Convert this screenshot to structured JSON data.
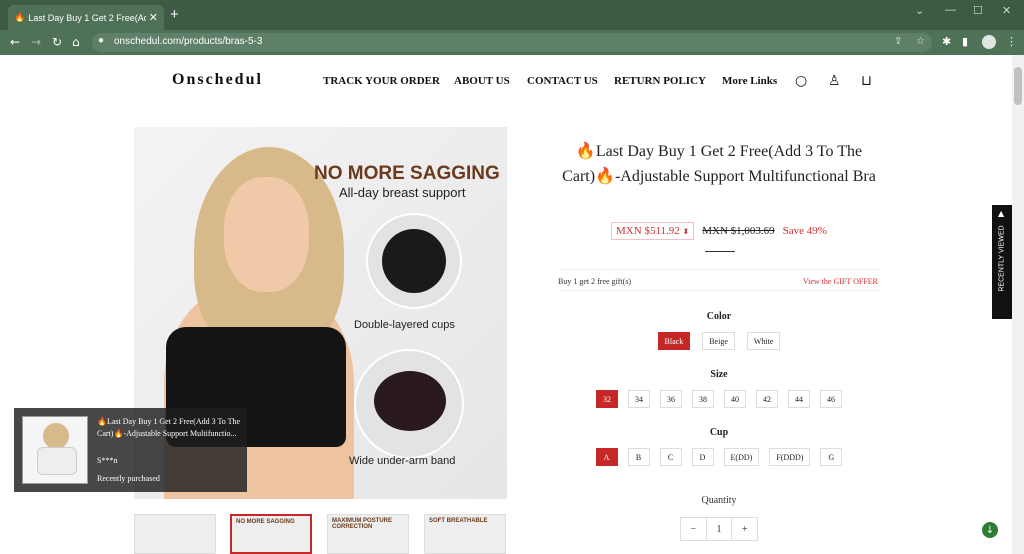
{
  "browser": {
    "tab_title": "Last Day Buy 1 Get 2 Free(Add",
    "tab_favicon": "🔥",
    "new_tab": "+",
    "url": "onschedul.com/products/bras-5-3",
    "window_controls": {
      "collapse": "⌄",
      "minimize": "—",
      "maximize": "☐",
      "close": "✕"
    }
  },
  "header": {
    "logo": "Onschedul",
    "nav": [
      "TRACK YOUR ORDER",
      "ABOUT US",
      "CONTACT US",
      "RETURN POLICY",
      "More Links"
    ],
    "icons": [
      "search-icon",
      "account-icon",
      "cart-icon"
    ]
  },
  "hero": {
    "headline": "NO MORE SAGGING",
    "subheadline": "All-day breast support",
    "caption1": "Double-layered cups",
    "caption2": "Wide under-arm band"
  },
  "thumbnails": [
    {
      "text": ""
    },
    {
      "text": "NO MORE SAGGING"
    },
    {
      "text": "MAXIMUM POSTURE CORRECTION"
    },
    {
      "text": "SOFT BREATHABLE"
    }
  ],
  "popup": {
    "title": "🔥Last Day Buy 1 Get 2 Free(Add 3 To The Cart)🔥-Adjustable Support Multifunctio...",
    "name": "S***n",
    "status": "Recently purchased"
  },
  "product": {
    "title": "🔥Last Day Buy 1 Get 2 Free(Add 3 To The Cart)🔥-Adjustable Support Multifunctional Bra",
    "price": "MXN $511.92",
    "old_price": "MXN $1,003.69",
    "save": "Save 49%",
    "gift_left": "Buy 1 get 2 free gift(s)",
    "gift_right": "View the GIFT OFFER",
    "color_label": "Color",
    "colors": [
      "Black",
      "Beige",
      "White"
    ],
    "size_label": "Size",
    "sizes": [
      "32",
      "34",
      "36",
      "38",
      "40",
      "42",
      "44",
      "46"
    ],
    "cup_label": "Cup",
    "cups": [
      "A",
      "B",
      "C",
      "D",
      "E(DD)",
      "F(DDD)",
      "G"
    ],
    "quantity_label": "Quantity",
    "quantity": "1",
    "minus": "−",
    "plus": "+"
  },
  "sidebar": {
    "recently_viewed": "RECENTLY VIEWED"
  },
  "colors": {
    "accent": "#c62828",
    "chrome": "#4e7158"
  }
}
